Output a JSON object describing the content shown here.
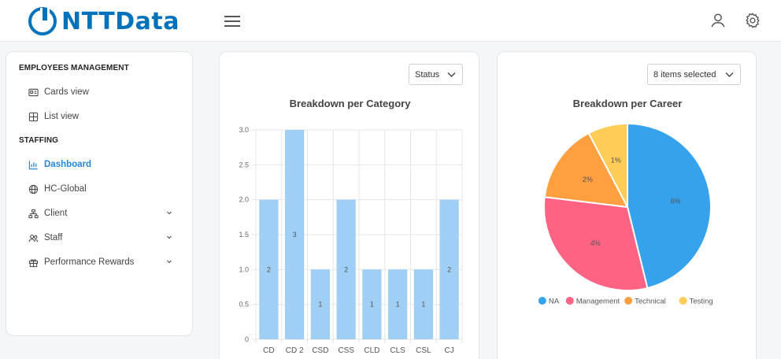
{
  "header": {
    "logo_text": "NTTData",
    "menu_icon": "hamburger-icon",
    "user_icon": "user-icon",
    "settings_icon": "gear-icon"
  },
  "sidebar": {
    "section1": "EMPLOYEES MANAGEMENT",
    "items1": [
      {
        "label": "Cards view",
        "icon": "id-card-icon"
      },
      {
        "label": "List view",
        "icon": "grid-icon"
      }
    ],
    "section2": "STAFFING",
    "items2": [
      {
        "label": "Dashboard",
        "icon": "bar-chart-icon",
        "active": true
      },
      {
        "label": "HC-Global",
        "icon": "globe-icon"
      },
      {
        "label": "Client",
        "icon": "org-chart-icon",
        "expandable": true
      },
      {
        "label": "Staff",
        "icon": "people-icon",
        "expandable": true
      },
      {
        "label": "Performance Rewards",
        "icon": "gift-icon",
        "expandable": true
      }
    ]
  },
  "category_card": {
    "filter_value": "Status",
    "title": "Breakdown per Category"
  },
  "career_card": {
    "filter_value": "8 items selected",
    "title": "Breakdown per Career"
  },
  "colors": {
    "accent": "#1e88e5",
    "bar": "#9fcff5",
    "na": "#36a2eb",
    "management": "#ff6384",
    "technical": "#ff9f40",
    "testing": "#ffcd56"
  },
  "chart_data": [
    {
      "type": "bar",
      "title": "Breakdown per Category",
      "categories": [
        "CD",
        "CD 2",
        "CSD",
        "CSS",
        "CLD",
        "CLS",
        "CSL",
        "CJ"
      ],
      "values": [
        2,
        3,
        1,
        2,
        1,
        1,
        1,
        2
      ],
      "data_labels": [
        "2",
        "3",
        "1",
        "2",
        "1",
        "1",
        "1",
        "2"
      ],
      "yticks": [
        "0",
        "0.5",
        "1.0",
        "1.5",
        "2.0",
        "2.5",
        "3.0"
      ],
      "ylim": [
        0,
        3
      ],
      "grid": true
    },
    {
      "type": "pie",
      "title": "Breakdown per Career",
      "series": [
        {
          "name": "NA",
          "value": 6,
          "label": "6%",
          "color": "#36a2eb"
        },
        {
          "name": "Management",
          "value": 4,
          "label": "4%",
          "color": "#ff6384"
        },
        {
          "name": "Technical",
          "value": 2,
          "label": "2%",
          "color": "#ff9f40"
        },
        {
          "name": "Testing",
          "value": 1,
          "label": "1%",
          "color": "#ffcd56"
        }
      ],
      "legend": "bottom"
    }
  ]
}
